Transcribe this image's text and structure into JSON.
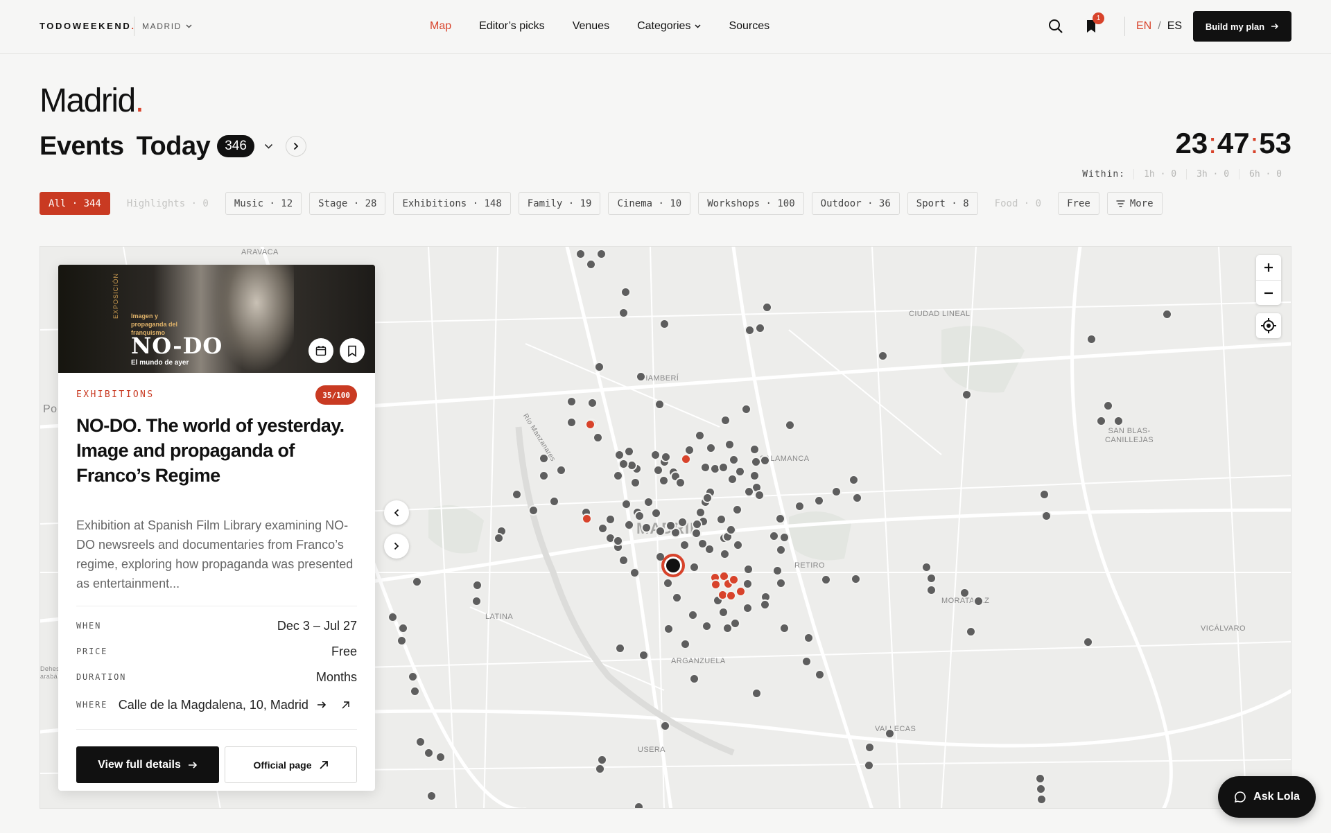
{
  "brand": {
    "logo_text": "TODOWEEKEND",
    "logo_dot": ".",
    "city_selector": "MADRID"
  },
  "nav": {
    "items": [
      "Map",
      "Editor’s picks",
      "Venues",
      "Categories",
      "Sources"
    ],
    "active": "Map"
  },
  "header": {
    "notification_count": "1",
    "lang_en": "EN",
    "lang_sep": "/",
    "lang_es": "ES",
    "build_plan": "Build my plan"
  },
  "colors": {
    "accent": "#d8432b",
    "dark": "#111111",
    "background": "#f6f6f5",
    "marker": "#5e5e5e"
  },
  "page": {
    "city": "Madrid",
    "city_dot": ".",
    "events_label": "Events",
    "day_label": "Today",
    "event_count": "346"
  },
  "clock": {
    "hours": "23",
    "minutes": "47",
    "seconds": "53",
    "sep": ":"
  },
  "within": {
    "label": "Within:",
    "options": [
      "1h · 0",
      "3h · 0",
      "6h · 0"
    ]
  },
  "filters": [
    {
      "label": "All · 344",
      "state": "active"
    },
    {
      "label": "Highlights · 0",
      "state": "disabled"
    },
    {
      "label": "Music · 12",
      "state": "normal"
    },
    {
      "label": "Stage · 28",
      "state": "normal"
    },
    {
      "label": "Exhibitions · 148",
      "state": "normal"
    },
    {
      "label": "Family · 19",
      "state": "normal"
    },
    {
      "label": "Cinema · 10",
      "state": "normal"
    },
    {
      "label": "Workshops · 100",
      "state": "normal"
    },
    {
      "label": "Outdoor · 36",
      "state": "normal"
    },
    {
      "label": "Sport · 8",
      "state": "normal"
    },
    {
      "label": "Food · 0",
      "state": "disabled"
    },
    {
      "label": "Free",
      "state": "normal"
    },
    {
      "label": "More",
      "state": "more"
    }
  ],
  "map": {
    "labels": [
      "ARAVACA",
      "CIUDAD LINEAL",
      "CHAMBERÍ",
      "SALAMANCA",
      "SAN BLAS-\nCANILLEJAS",
      "MADRID",
      "RETIRO",
      "LATINA",
      "MORATALAZ",
      "VICÁLVARO",
      "ARGANZUELA",
      "VALLECAS",
      "USERA",
      "Po",
      "Dehes\narabá"
    ],
    "river_label": "Río Manzanares",
    "zoom_in": "+",
    "zoom_out": "−"
  },
  "event_card": {
    "image": {
      "poster_side": "EXPOSICIÓN",
      "poster_sub": "Imagen y propaganda del franquismo",
      "poster_title": "NO-DO",
      "poster_caption": "El mundo de ayer"
    },
    "category": "EXHIBITIONS",
    "score": "35/100",
    "title": "NO-DO. The world of yesterday. Image and propaganda of Franco’s Regime",
    "description": "Exhibition at Spanish Film Library examining NO-DO newsreels and documentaries from Franco’s regime, exploring how propaganda was presented as entertainment...",
    "when_label": "WHEN",
    "when": "Dec 3 – Jul 27",
    "price_label": "PRICE",
    "price": "Free",
    "duration_label": "DURATION",
    "duration": "Months",
    "where_label": "WHERE",
    "where": "Calle de la Magdalena, 10, Madrid",
    "view_details": "View full details",
    "official_page": "Official page"
  },
  "assistant": {
    "label": "Ask Lola"
  }
}
